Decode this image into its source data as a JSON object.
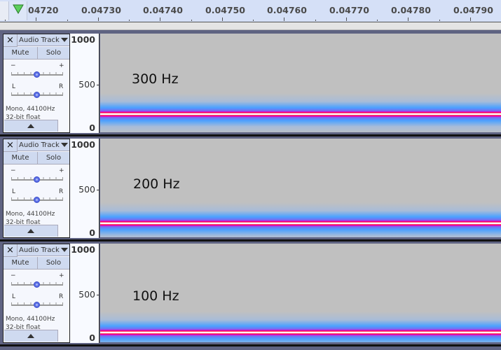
{
  "ruler": {
    "ticks": [
      "04720",
      "0.04730",
      "0.04740",
      "0.04750",
      "0.04760",
      "0.04770",
      "0.04780",
      "0.04790"
    ],
    "play_head_color": "#5ccf5c"
  },
  "tracks": [
    {
      "name": "Audio Track",
      "mute_label": "Mute",
      "solo_label": "Solo",
      "gain_min_label": "−",
      "gain_max_label": "+",
      "pan_left_label": "L",
      "pan_right_label": "R",
      "info_line1": "Mono, 44100Hz",
      "info_line2": "32-bit float",
      "scale_max": "1000",
      "scale_mid": "500",
      "scale_min": "0",
      "frequency_label": "300 Hz",
      "frequency_hz": 300
    },
    {
      "name": "Audio Track",
      "mute_label": "Mute",
      "solo_label": "Solo",
      "gain_min_label": "−",
      "gain_max_label": "+",
      "pan_left_label": "L",
      "pan_right_label": "R",
      "info_line1": "Mono, 44100Hz",
      "info_line2": "32-bit float",
      "scale_max": "1000",
      "scale_mid": "500",
      "scale_min": "0",
      "frequency_label": "200 Hz",
      "frequency_hz": 200
    },
    {
      "name": "Audio Track",
      "mute_label": "Mute",
      "solo_label": "Solo",
      "gain_min_label": "−",
      "gain_max_label": "+",
      "pan_left_label": "L",
      "pan_right_label": "R",
      "info_line1": "Mono, 44100Hz",
      "info_line2": "32-bit float",
      "scale_max": "1000",
      "scale_mid": "500",
      "scale_min": "0",
      "frequency_label": "100 Hz",
      "frequency_hz": 100
    }
  ],
  "colors": {
    "spectrogram_bg": "#c0c0c0",
    "band_peak": "#ffffff",
    "band_red": "#ff0022",
    "band_magenta": "#e600c8",
    "band_blue": "#4aa0ff"
  }
}
